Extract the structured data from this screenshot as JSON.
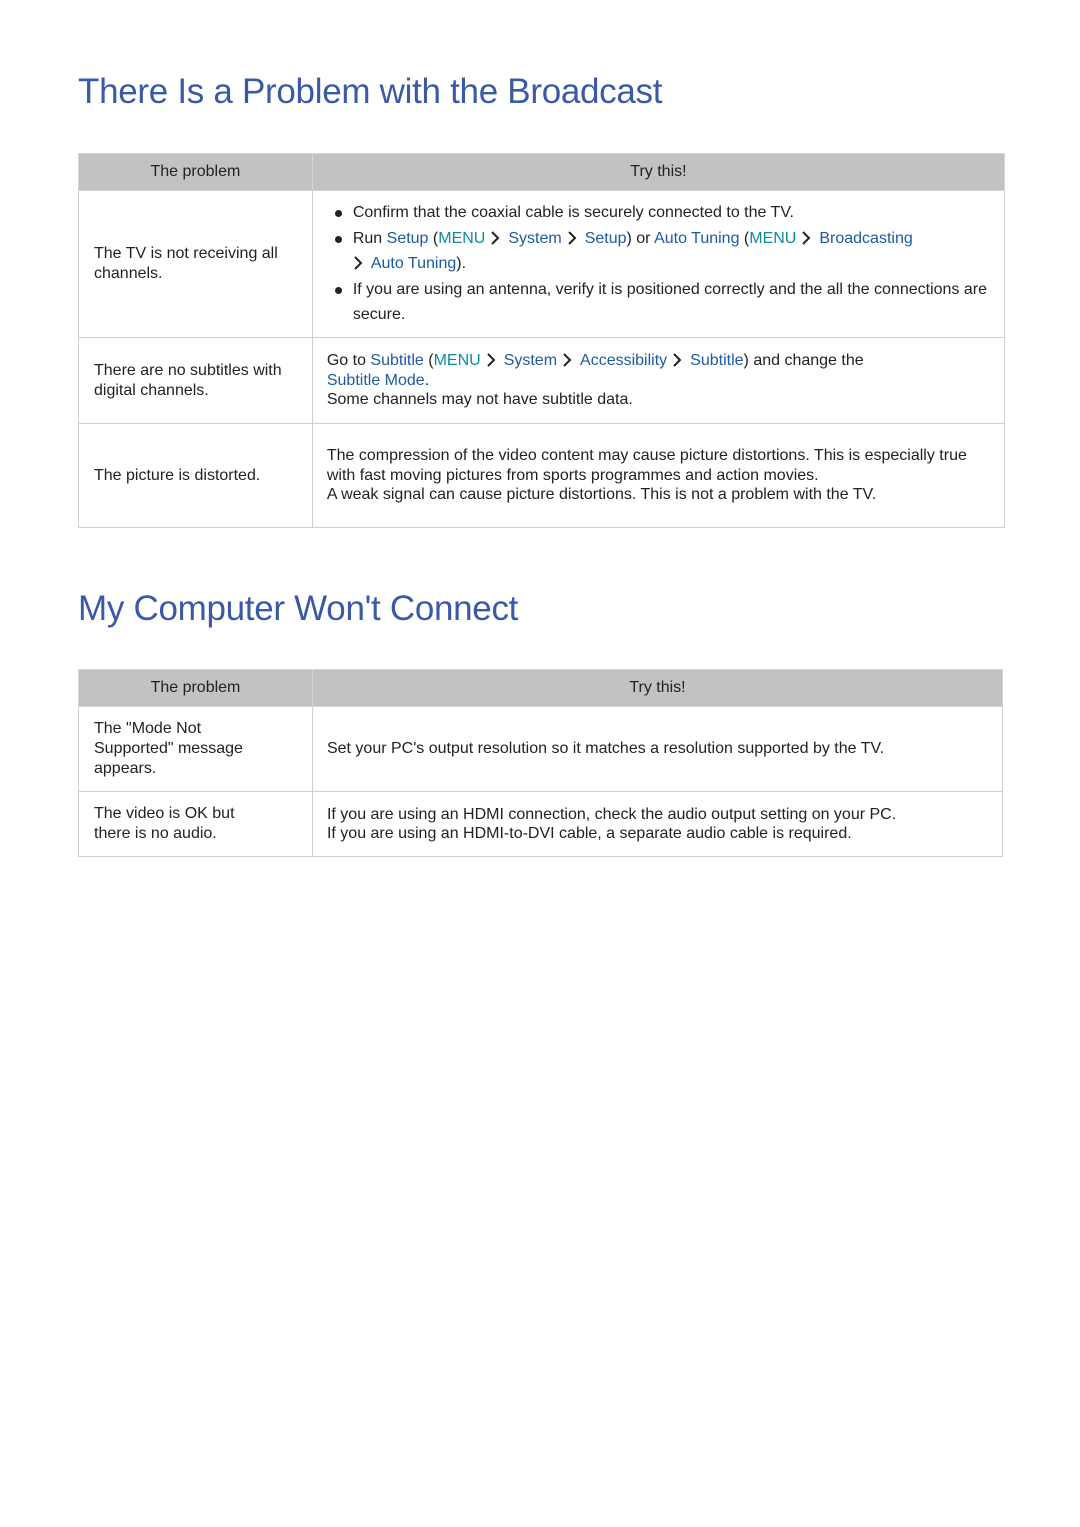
{
  "colors": {
    "heading": "#3a5aa6",
    "link": "#1d5aa1",
    "menu": "#0f8a9c",
    "table_header_bg": "#c1c2c4"
  },
  "section1": {
    "title": "There Is a Problem with the Broadcast",
    "headers": [
      "The problem",
      "Try this!"
    ],
    "rows": [
      {
        "problem": "The TV is not receiving all channels.",
        "bullets": {
          "b1": "Confirm that the coaxial cable is securely connected to the TV.",
          "b2": {
            "run": "Run ",
            "setup": "Setup",
            "open1": " (",
            "menu1": "MENU",
            "system": "System",
            "setup2": "Setup",
            "close1": ") or ",
            "auto": "Auto Tuning",
            "open2": " (",
            "menu2": "MENU",
            "broadcasting": "Broadcasting",
            "auto2": "Auto Tuning",
            "close2": ")."
          },
          "b3": "If you are using an antenna, verify it is positioned correctly and the all the connections are secure."
        }
      },
      {
        "problem": "There are no subtitles with digital channels.",
        "try": {
          "goto": "Go to ",
          "subtitle": "Subtitle",
          "open": " (",
          "menu": "MENU",
          "system": "System",
          "accessibility": "Accessibility",
          "subtitle2": "Subtitle",
          "close": ") and change the ",
          "mode": "Subtitle Mode",
          "period": ".",
          "note": "Some channels may not have subtitle data."
        }
      },
      {
        "problem": "The picture is distorted.",
        "try": {
          "line1": "The compression of the video content may cause picture distortions. This is especially true with fast moving pictures from sports programmes and action movies.",
          "line2": "A weak signal can cause picture distortions. This is not a problem with the TV."
        }
      }
    ]
  },
  "section2": {
    "title": "My Computer Won't Connect",
    "headers": [
      "The problem",
      "Try this!"
    ],
    "rows": [
      {
        "problem": "The \"Mode Not Supported\" message appears.",
        "try": "Set your PC's output resolution so it matches a resolution supported by the TV."
      },
      {
        "problem": "The video is OK but there is no audio.",
        "try1": "If you are using an HDMI connection, check the audio output setting on your PC.",
        "try2": "If you are using an HDMI-to-DVI cable, a separate audio cable is required."
      }
    ]
  }
}
